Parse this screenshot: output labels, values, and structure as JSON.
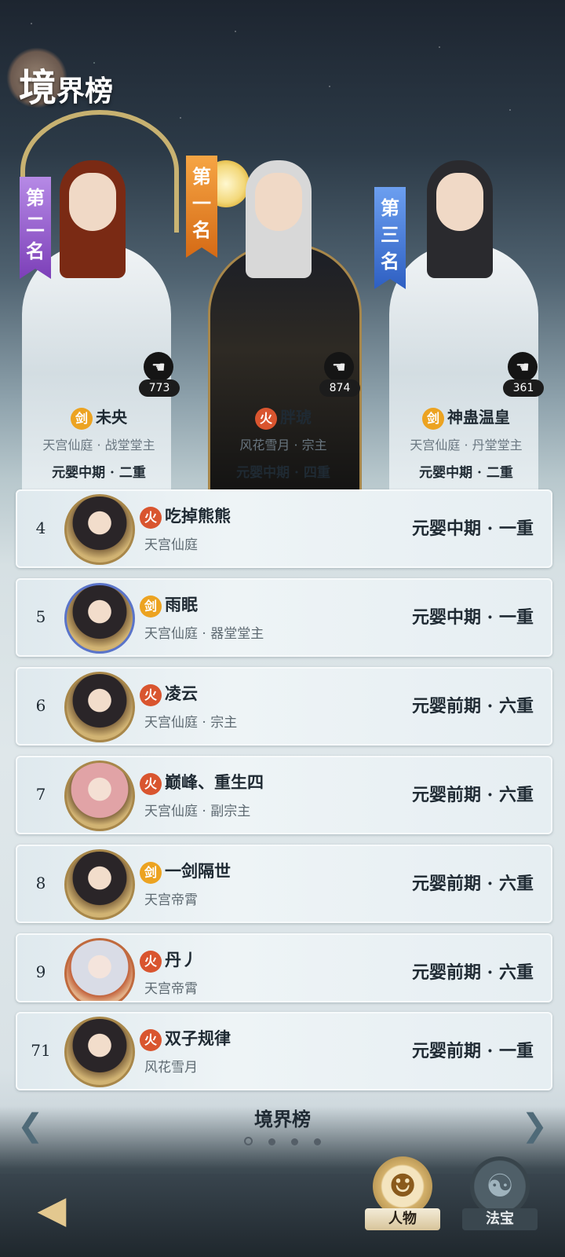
{
  "header": {
    "title_big": "境",
    "title_small": "界榜"
  },
  "podium": [
    {
      "rank_label": "第二名",
      "name": "未央",
      "element": "剑",
      "guild": "天宫仙庭 · 战堂堂主",
      "level": "元婴中期 · 二重",
      "likes": "773"
    },
    {
      "rank_label": "第一名",
      "name": "胖琥",
      "element": "火",
      "guild": "风花雪月 · 宗主",
      "level": "元婴中期 · 四重",
      "likes": "874"
    },
    {
      "rank_label": "第三名",
      "name": "神蛊温皇",
      "element": "剑",
      "guild": "天宫仙庭 · 丹堂堂主",
      "level": "元婴中期 · 二重",
      "likes": "361"
    }
  ],
  "rankings": [
    {
      "rank": "4",
      "element": "火",
      "name": "吃掉熊熊",
      "guild": "天宫仙庭",
      "level": "元婴中期 · 一重"
    },
    {
      "rank": "5",
      "element": "剑",
      "name": "雨眠",
      "guild": "天宫仙庭 · 器堂堂主",
      "level": "元婴中期 · 一重"
    },
    {
      "rank": "6",
      "element": "火",
      "name": "凌云",
      "guild": "天宫仙庭 · 宗主",
      "level": "元婴前期 · 六重"
    },
    {
      "rank": "7",
      "element": "火",
      "name": "巅峰、重生四",
      "guild": "天宫仙庭 · 副宗主",
      "level": "元婴前期 · 六重"
    },
    {
      "rank": "8",
      "element": "剑",
      "name": "一剑隔世",
      "guild": "天宫帝霄",
      "level": "元婴前期 · 六重"
    },
    {
      "rank": "9",
      "element": "火",
      "name": "丹丿",
      "guild": "天宫帝霄",
      "level": "元婴前期 · 六重"
    }
  ],
  "self_row": {
    "rank": "71",
    "element": "火",
    "name": "双子规律",
    "guild": "风花雪月",
    "level": "元婴前期 · 一重"
  },
  "pager": {
    "title": "境界榜",
    "current_page": 1,
    "total_pages": 4
  },
  "nav": {
    "btn1": "人物",
    "btn2": "法宝"
  },
  "icons": {
    "left_arrow": "chevron-left-icon",
    "right_arrow": "chevron-right-icon",
    "back": "back-icon",
    "like": "thumb-icon"
  },
  "colors": {
    "sword": "#eca321",
    "fire": "#d9552f",
    "rank1": "#e27a22",
    "rank2": "#8f55cc",
    "rank3": "#3e6fd0"
  }
}
